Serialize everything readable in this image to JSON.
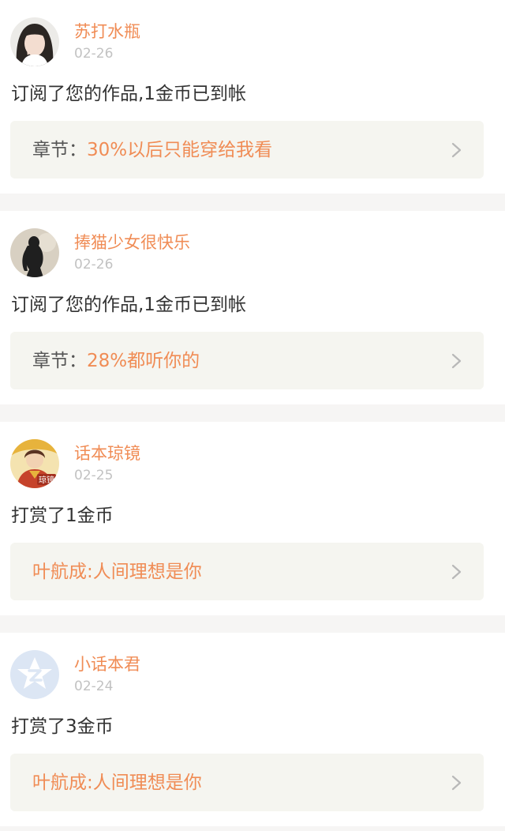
{
  "notifications": [
    {
      "username": "苏打水瓶",
      "date": "02-26",
      "message": "订阅了您的作品,1金币已到帐",
      "ref_prefix": "章节：",
      "ref_title": "30%以后只能穿给我看",
      "avatar_icon": "girl-portrait-avatar"
    },
    {
      "username": "捧猫少女很快乐",
      "date": "02-26",
      "message": "订阅了您的作品,1金币已到帐",
      "ref_prefix": "章节：",
      "ref_title": "28%都听你的",
      "avatar_icon": "silhouette-avatar"
    },
    {
      "username": "话本琼镜",
      "date": "02-25",
      "message": "打赏了1金币",
      "ref_prefix": "",
      "ref_title": "叶航成:人间理想是你",
      "avatar_icon": "illustrated-avatar",
      "avatar_badge": "琼镜"
    },
    {
      "username": "小话本君",
      "date": "02-24",
      "message": "打赏了3金币",
      "ref_prefix": "",
      "ref_title": "叶航成:人间理想是你",
      "avatar_icon": "default-star-avatar"
    }
  ],
  "colors": {
    "accent": "#f08c55",
    "date_gray": "#c2c2c2",
    "text": "#333333",
    "ref_box_bg": "#f5f5f0",
    "separator": "#f6f5f4"
  }
}
